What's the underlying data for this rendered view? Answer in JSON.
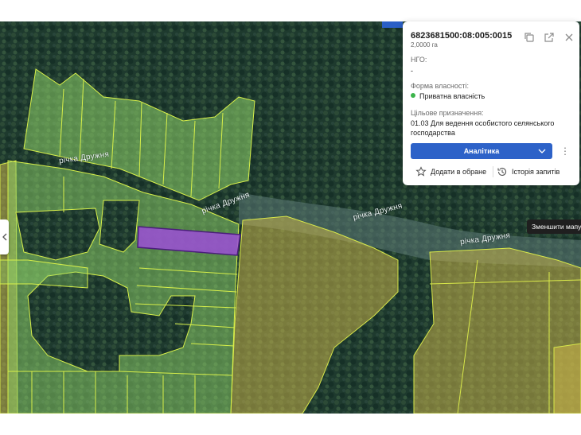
{
  "map": {
    "river_labels": [
      "річка Дружня",
      "річка Дружня",
      "річка Дружня",
      "річка Дружня"
    ]
  },
  "parcel_card": {
    "cadastral_number": "6823681500:08:005:0015",
    "area": "2,0000 га",
    "ngo_label": "НГО:",
    "ngo_value": "-",
    "ownership_label": "Форма власності:",
    "ownership_value": "Приватна власність",
    "purpose_label": "Цільове призначення:",
    "purpose_value": "01.03 Для ведення особистого селянського господарства",
    "analytics_button": "Аналітика",
    "favorite_action": "Додати в обране",
    "history_action": "Історія запитів"
  },
  "tooltip": "Зменшити мапу",
  "colors": {
    "ownership_status": "#3cb44b",
    "primary_button": "#2d62c8",
    "selected_parcel": "#9b4fd6",
    "private_parcels": "#8fd36a",
    "state_parcels": "#c6b24a"
  }
}
